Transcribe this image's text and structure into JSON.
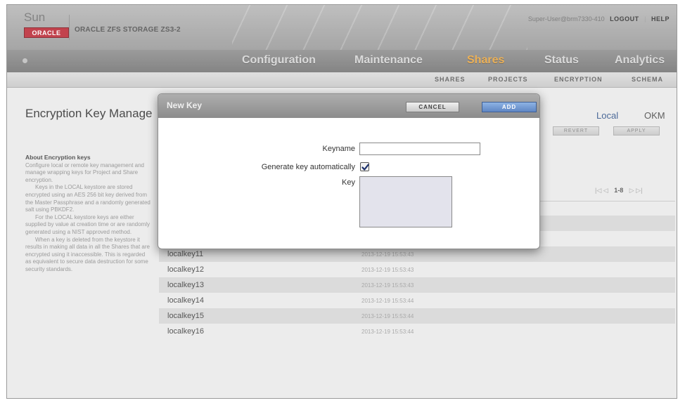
{
  "header": {
    "logo_sun": "Sun",
    "logo_oracle": "ORACLE",
    "product_name": "ORACLE ZFS STORAGE ZS3-2",
    "user": "Super-User@brm7330-410",
    "logout": "LOGOUT",
    "help": "HELP"
  },
  "nav": {
    "tabs": [
      {
        "label": "Configuration"
      },
      {
        "label": "Maintenance"
      },
      {
        "label": "Shares"
      },
      {
        "label": "Status"
      },
      {
        "label": "Analytics"
      }
    ],
    "active": "Shares"
  },
  "subnav": {
    "tabs": [
      {
        "label": "SHARES"
      },
      {
        "label": "PROJECTS"
      },
      {
        "label": "ENCRYPTION"
      },
      {
        "label": "SCHEMA"
      }
    ]
  },
  "page": {
    "title": "Encryption Key Manage",
    "keystore_local": "Local",
    "keystore_okm": "OKM",
    "revert_label": "REVERT",
    "apply_label": "APPLY",
    "pager_first": "|◁ ◁",
    "pager_range": "1-8",
    "pager_last": "▷ ▷|"
  },
  "about": {
    "heading": "About Encryption keys",
    "p1": "Configure local or remote key management and manage wrapping keys for Project and Share encryption.",
    "p2": "Keys in the LOCAL keystore are stored encrypted using an AES 256 bit key derived from the Master Passphrase and a randomly generated salt using PBKDF2.",
    "p3": "For the LOCAL keystore keys are either supplied by value at creation time or are randomly generated using a NIST approved method.",
    "p4": "When a key is deleted from the keystore it results in making all data in all the Shares that are encrypted using it inaccessible. This is regarded as equivalent to secure data destruction for some security standards."
  },
  "keys": [
    {
      "name": "localkey11",
      "date": "2013-12-19 15:53:43"
    },
    {
      "name": "localkey12",
      "date": "2013-12-19 15:53:43"
    },
    {
      "name": "localkey13",
      "date": "2013-12-19 15:53:43"
    },
    {
      "name": "localkey14",
      "date": "2013-12-19 15:53:44"
    },
    {
      "name": "localkey15",
      "date": "2013-12-19 15:53:44"
    },
    {
      "name": "localkey16",
      "date": "2013-12-19 15:53:44"
    }
  ],
  "modal": {
    "title": "New Key",
    "cancel": "CANCEL",
    "add": "ADD",
    "keyname_label": "Keyname",
    "keyname_value": "",
    "generate_label": "Generate key automatically",
    "generate_checked": true,
    "key_label": "Key",
    "key_value": ""
  },
  "colors": {
    "accent_active_tab": "#e8a33a",
    "oracle_red": "#b8232f",
    "add_button": "#5f86c4"
  }
}
